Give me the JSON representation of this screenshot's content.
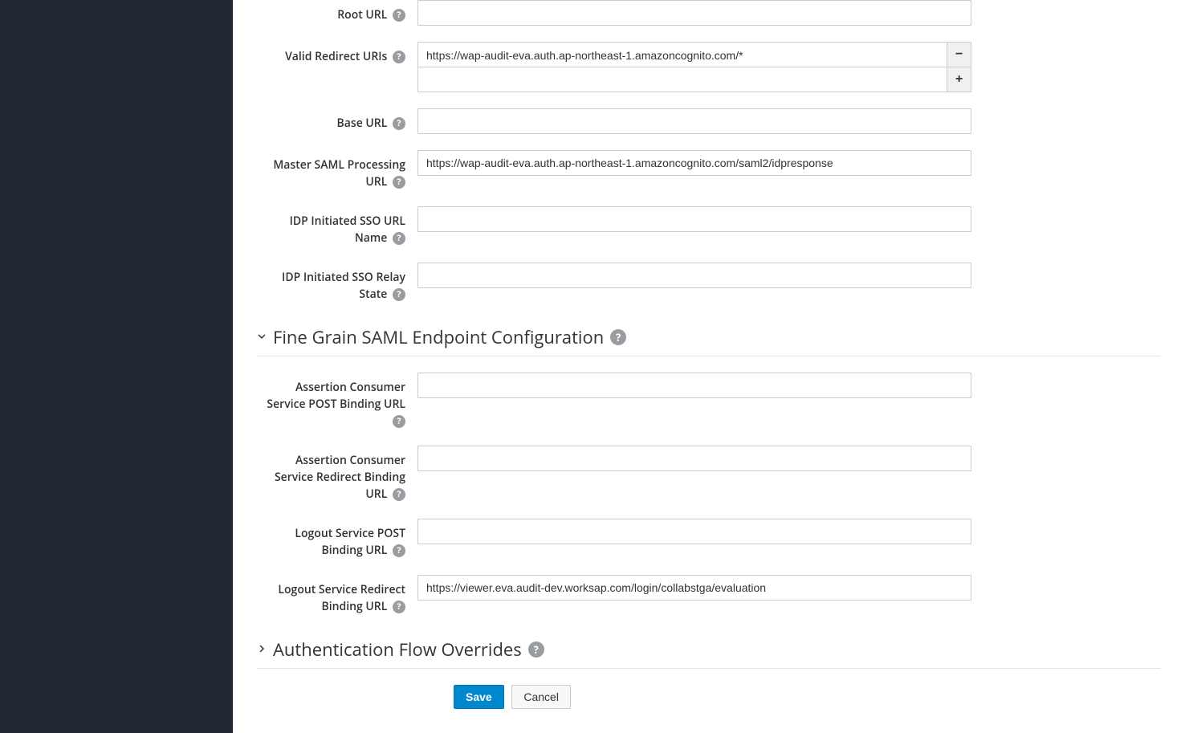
{
  "form": {
    "root_url": {
      "label": "Root URL",
      "value": ""
    },
    "valid_redirect_uris": {
      "label": "Valid Redirect URIs",
      "rows": [
        {
          "value": "https://wap-audit-eva.auth.ap-northeast-1.amazoncognito.com/*",
          "action": "remove"
        },
        {
          "value": "",
          "action": "add"
        }
      ]
    },
    "base_url": {
      "label": "Base URL",
      "value": ""
    },
    "master_saml_processing_url": {
      "label": "Master SAML Processing URL",
      "value": "https://wap-audit-eva.auth.ap-northeast-1.amazoncognito.com/saml2/idpresponse"
    },
    "idp_initiated_sso_url_name": {
      "label": "IDP Initiated SSO URL Name",
      "value": ""
    },
    "idp_initiated_sso_relay_state": {
      "label": "IDP Initiated SSO Relay State",
      "value": ""
    }
  },
  "sections": {
    "fine_grain": {
      "title": "Fine Grain SAML Endpoint Configuration",
      "expanded": true,
      "fields": {
        "acs_post_binding_url": {
          "label": "Assertion Consumer Service POST Binding URL",
          "value": ""
        },
        "acs_redirect_binding_url": {
          "label": "Assertion Consumer Service Redirect Binding URL",
          "value": ""
        },
        "logout_post_binding_url": {
          "label": "Logout Service POST Binding URL",
          "value": ""
        },
        "logout_redirect_binding_url": {
          "label": "Logout Service Redirect Binding URL",
          "value": "https://viewer.eva.audit-dev.worksap.com/login/collabstga/evaluation"
        }
      }
    },
    "auth_flow_overrides": {
      "title": "Authentication Flow Overrides",
      "expanded": false
    }
  },
  "actions": {
    "save": "Save",
    "cancel": "Cancel"
  },
  "glyphs": {
    "help": "?",
    "minus": "−",
    "plus": "+"
  }
}
